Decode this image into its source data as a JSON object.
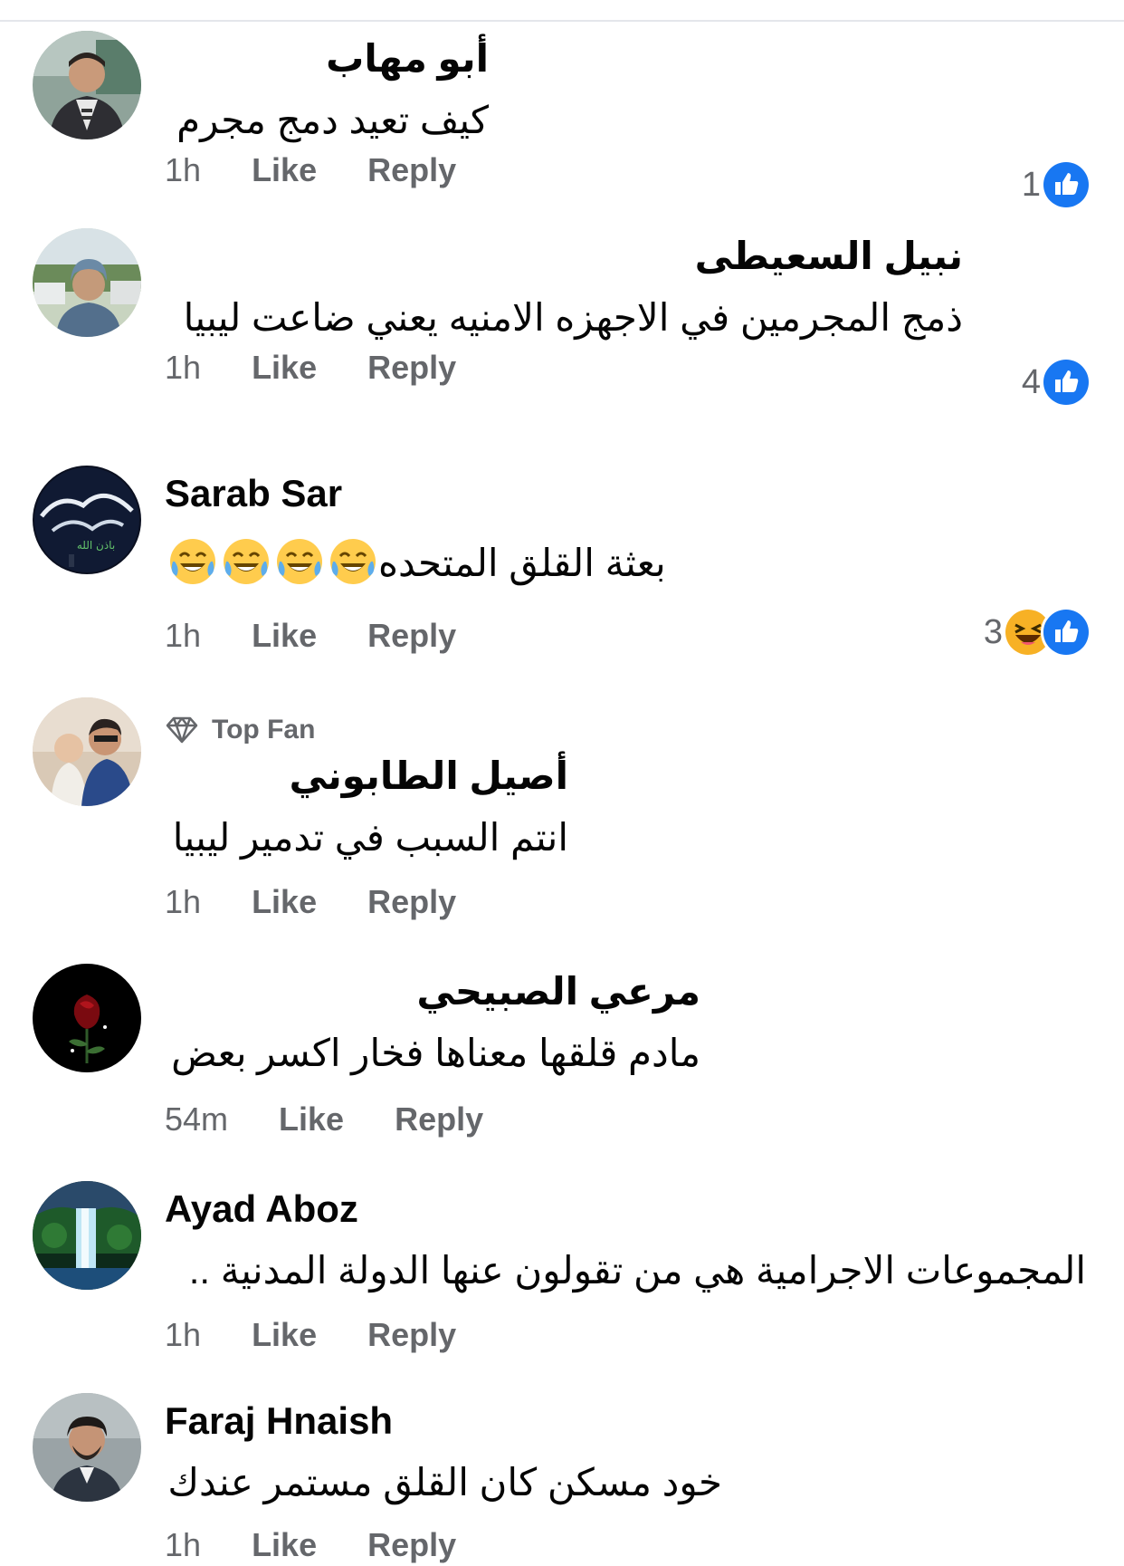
{
  "labels": {
    "like": "Like",
    "reply": "Reply",
    "top_fan": "Top Fan"
  },
  "colors": {
    "like_blue": "#1877f2",
    "meta_gray": "#65676b"
  },
  "comments": [
    {
      "name": "أبو مهاب",
      "text": "كيف تعيد دمج مجرم",
      "time": "1h",
      "reaction_count": "1",
      "reactions": [
        "like-icon"
      ]
    },
    {
      "name": "نبيل السعيطى",
      "text": "ذمج المجرمين في الاجهزه الامنيه يعني ضاعت ليبيا",
      "time": "1h",
      "reaction_count": "4",
      "reactions": [
        "like-icon"
      ]
    },
    {
      "name": "Sarab Sar",
      "text": "بعثة القلق المتحده",
      "emoji_count": 4,
      "emoji": "laughing-crying-emoji",
      "time": "1h",
      "reaction_count": "3",
      "reactions": [
        "haha-icon",
        "like-icon"
      ]
    },
    {
      "name": "أصيل الطابوني",
      "badge": "Top Fan",
      "text": "انتم السبب في تدمير ليبيا",
      "time": "1h"
    },
    {
      "name": "مرعي الصبيحي",
      "text": "مادم قلقها معناها فخار اكسر بعض",
      "time": "54m"
    },
    {
      "name": "Ayad Aboz",
      "text": "المجموعات الاجرامية هي من تقولون عنها الدولة المدنية ..",
      "time": "1h"
    },
    {
      "name": "Faraj Hnaish",
      "text": "خود مسكن كان القلق مستمر عندك",
      "time": "1h"
    }
  ]
}
